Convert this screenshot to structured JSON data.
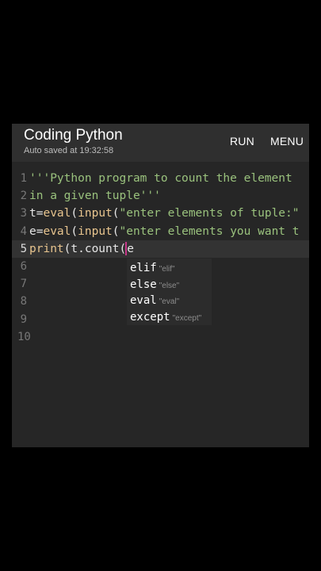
{
  "header": {
    "title": "Coding Python",
    "subtitle": "Auto saved at 19:32:58",
    "run_label": "RUN",
    "menu_label": "MENU"
  },
  "editor": {
    "lines": [
      {
        "number": "1",
        "parts": [
          {
            "t": "s",
            "text": "'''Python program to count the element"
          }
        ]
      },
      {
        "number": "2",
        "parts": [
          {
            "t": "s",
            "text": "in a given tuple'''"
          }
        ]
      },
      {
        "number": "3",
        "parts": [
          {
            "t": "v",
            "text": "t="
          },
          {
            "t": "f",
            "text": "eval"
          },
          {
            "t": "v",
            "text": "("
          },
          {
            "t": "f",
            "text": "input"
          },
          {
            "t": "v",
            "text": "("
          },
          {
            "t": "s",
            "text": "\"enter elements of tuple:\""
          }
        ]
      },
      {
        "number": "4",
        "parts": [
          {
            "t": "v",
            "text": "e="
          },
          {
            "t": "f",
            "text": "eval"
          },
          {
            "t": "v",
            "text": "("
          },
          {
            "t": "f",
            "text": "input"
          },
          {
            "t": "v",
            "text": "("
          },
          {
            "t": "s",
            "text": "\"enter elements you want t"
          }
        ]
      },
      {
        "number": "5",
        "active": true,
        "parts": [
          {
            "t": "f",
            "text": "print"
          },
          {
            "t": "v",
            "text": "(t.count("
          },
          {
            "t": "caret",
            "text": ""
          },
          {
            "t": "v",
            "text": "e"
          }
        ]
      },
      {
        "number": "6",
        "parts": []
      },
      {
        "number": "7",
        "parts": []
      },
      {
        "number": "8",
        "parts": []
      },
      {
        "number": "9",
        "parts": []
      },
      {
        "number": "10",
        "parts": []
      }
    ]
  },
  "autocomplete": {
    "items": [
      {
        "keyword": "elif",
        "hint": "\"elif\""
      },
      {
        "keyword": "else",
        "hint": "\"else\""
      },
      {
        "keyword": "eval",
        "hint": "\"eval\""
      },
      {
        "keyword": "except",
        "hint": "\"except\""
      }
    ]
  },
  "colors": {
    "background": "#000000",
    "app_bar": "#2f2f2f",
    "editor": "#262626",
    "string": "#9ac27d",
    "builtin": "#e7c48e",
    "caret": "#c8378a"
  }
}
